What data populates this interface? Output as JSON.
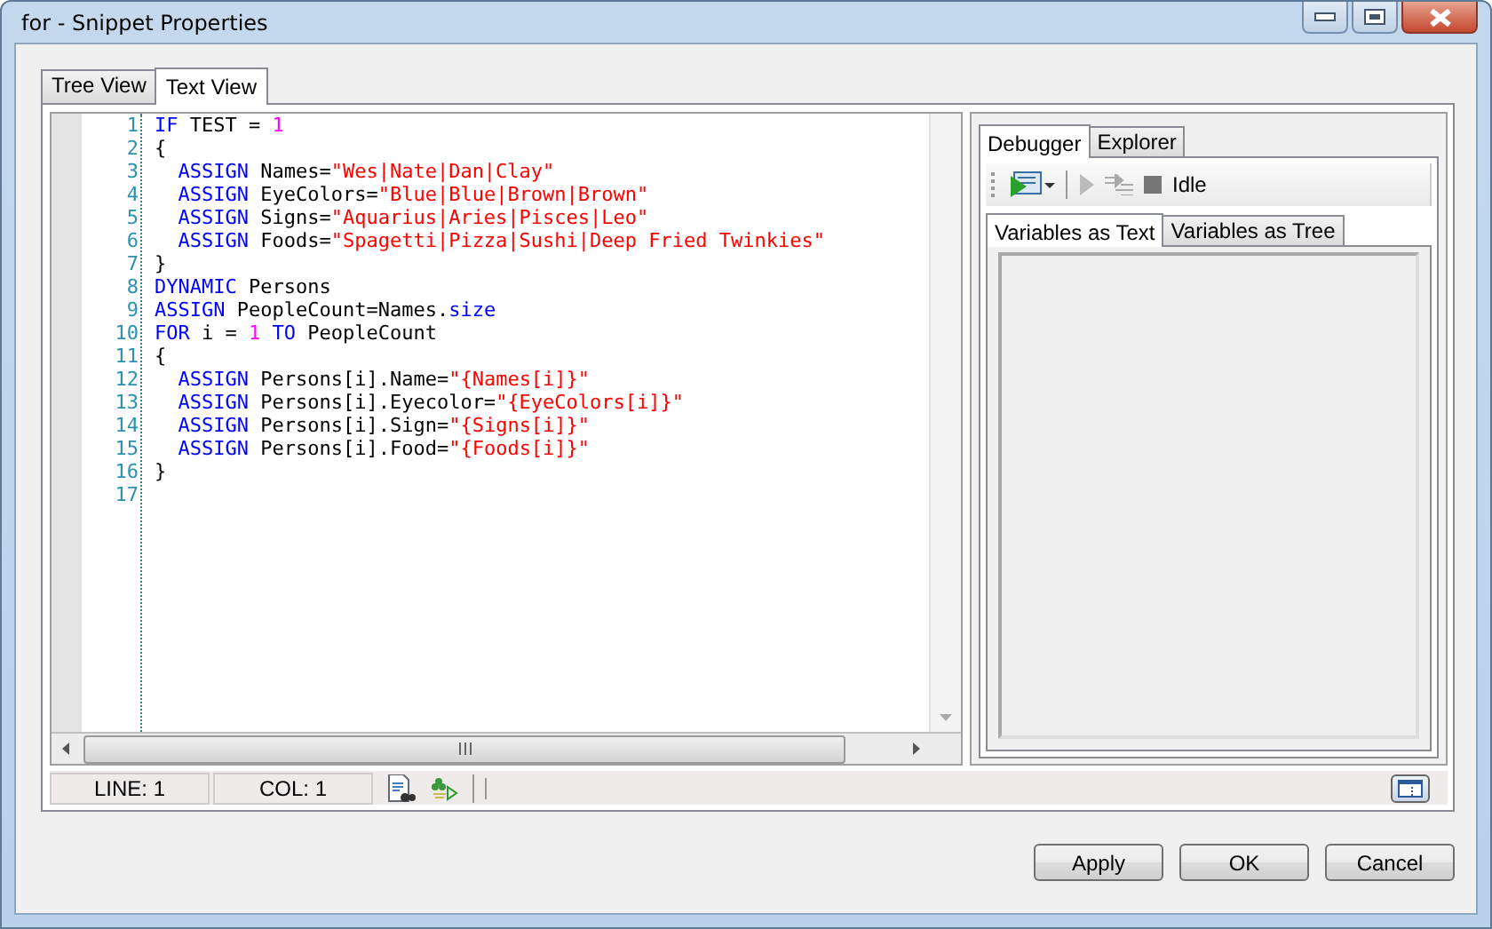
{
  "window": {
    "title": "for - Snippet Properties"
  },
  "tabs": [
    {
      "label": "Tree View",
      "selected": false
    },
    {
      "label": "Text View",
      "selected": true
    }
  ],
  "editor": {
    "lines": [
      {
        "number": "1",
        "tokens": [
          {
            "t": "IF",
            "kind": "keyword"
          },
          {
            "t": " TEST = ",
            "kind": "plain"
          },
          {
            "t": "1",
            "kind": "number"
          }
        ]
      },
      {
        "number": "2",
        "tokens": [
          {
            "t": "{",
            "kind": "plain"
          }
        ]
      },
      {
        "number": "3",
        "tokens": [
          {
            "t": "  ASSIGN",
            "kind": "keyword"
          },
          {
            "t": " Names=",
            "kind": "plain"
          },
          {
            "t": "\"Wes|Nate|Dan|Clay\"",
            "kind": "string"
          }
        ]
      },
      {
        "number": "4",
        "tokens": [
          {
            "t": "  ASSIGN",
            "kind": "keyword"
          },
          {
            "t": " EyeColors=",
            "kind": "plain"
          },
          {
            "t": "\"Blue|Blue|Brown|Brown\"",
            "kind": "string"
          }
        ]
      },
      {
        "number": "5",
        "tokens": [
          {
            "t": "  ASSIGN",
            "kind": "keyword"
          },
          {
            "t": " Signs=",
            "kind": "plain"
          },
          {
            "t": "\"Aquarius|Aries|Pisces|Leo\"",
            "kind": "string"
          }
        ]
      },
      {
        "number": "6",
        "tokens": [
          {
            "t": "  ASSIGN",
            "kind": "keyword"
          },
          {
            "t": " Foods=",
            "kind": "plain"
          },
          {
            "t": "\"Spagetti|Pizza|Sushi|Deep Fried Twinkies\"",
            "kind": "string"
          }
        ]
      },
      {
        "number": "7",
        "tokens": [
          {
            "t": "}",
            "kind": "plain"
          }
        ]
      },
      {
        "number": "8",
        "tokens": [
          {
            "t": "DYNAMIC",
            "kind": "keyword"
          },
          {
            "t": " Persons",
            "kind": "plain"
          }
        ]
      },
      {
        "number": "9",
        "tokens": [
          {
            "t": "ASSIGN",
            "kind": "keyword"
          },
          {
            "t": " PeopleCount=Names.",
            "kind": "plain"
          },
          {
            "t": "size",
            "kind": "keyword"
          }
        ]
      },
      {
        "number": "10",
        "tokens": [
          {
            "t": "FOR",
            "kind": "keyword"
          },
          {
            "t": " i = ",
            "kind": "plain"
          },
          {
            "t": "1",
            "kind": "number"
          },
          {
            "t": " TO",
            "kind": "keyword"
          },
          {
            "t": " PeopleCount",
            "kind": "plain"
          }
        ]
      },
      {
        "number": "11",
        "tokens": [
          {
            "t": "{",
            "kind": "plain"
          }
        ]
      },
      {
        "number": "12",
        "tokens": [
          {
            "t": "  ASSIGN",
            "kind": "keyword"
          },
          {
            "t": " Persons[i].Name=",
            "kind": "plain"
          },
          {
            "t": "\"{Names[i]}\"",
            "kind": "string"
          }
        ]
      },
      {
        "number": "13",
        "tokens": [
          {
            "t": "  ASSIGN",
            "kind": "keyword"
          },
          {
            "t": " Persons[i].Eyecolor=",
            "kind": "plain"
          },
          {
            "t": "\"{EyeColors[i]}\"",
            "kind": "string"
          }
        ]
      },
      {
        "number": "14",
        "tokens": [
          {
            "t": "  ASSIGN",
            "kind": "keyword"
          },
          {
            "t": " Persons[i].Sign=",
            "kind": "plain"
          },
          {
            "t": "\"{Signs[i]}\"",
            "kind": "string"
          }
        ]
      },
      {
        "number": "15",
        "tokens": [
          {
            "t": "  ASSIGN",
            "kind": "keyword"
          },
          {
            "t": " Persons[i].Food=",
            "kind": "plain"
          },
          {
            "t": "\"{Foods[i]}\"",
            "kind": "string"
          }
        ]
      },
      {
        "number": "16",
        "tokens": [
          {
            "t": "}",
            "kind": "plain"
          }
        ]
      },
      {
        "number": "17"
      }
    ]
  },
  "status_bar": {
    "line": "LINE: 1",
    "col": "COL: 1"
  },
  "debugger": {
    "tabs": [
      {
        "label": "Debugger",
        "selected": true
      },
      {
        "label": "Explorer",
        "selected": false
      }
    ],
    "status": "Idle",
    "variable_tabs": [
      {
        "label": "Variables as Text",
        "selected": true
      },
      {
        "label": "Variables as Tree",
        "selected": false
      }
    ]
  },
  "buttons": [
    "Apply",
    "OK",
    "Cancel"
  ]
}
